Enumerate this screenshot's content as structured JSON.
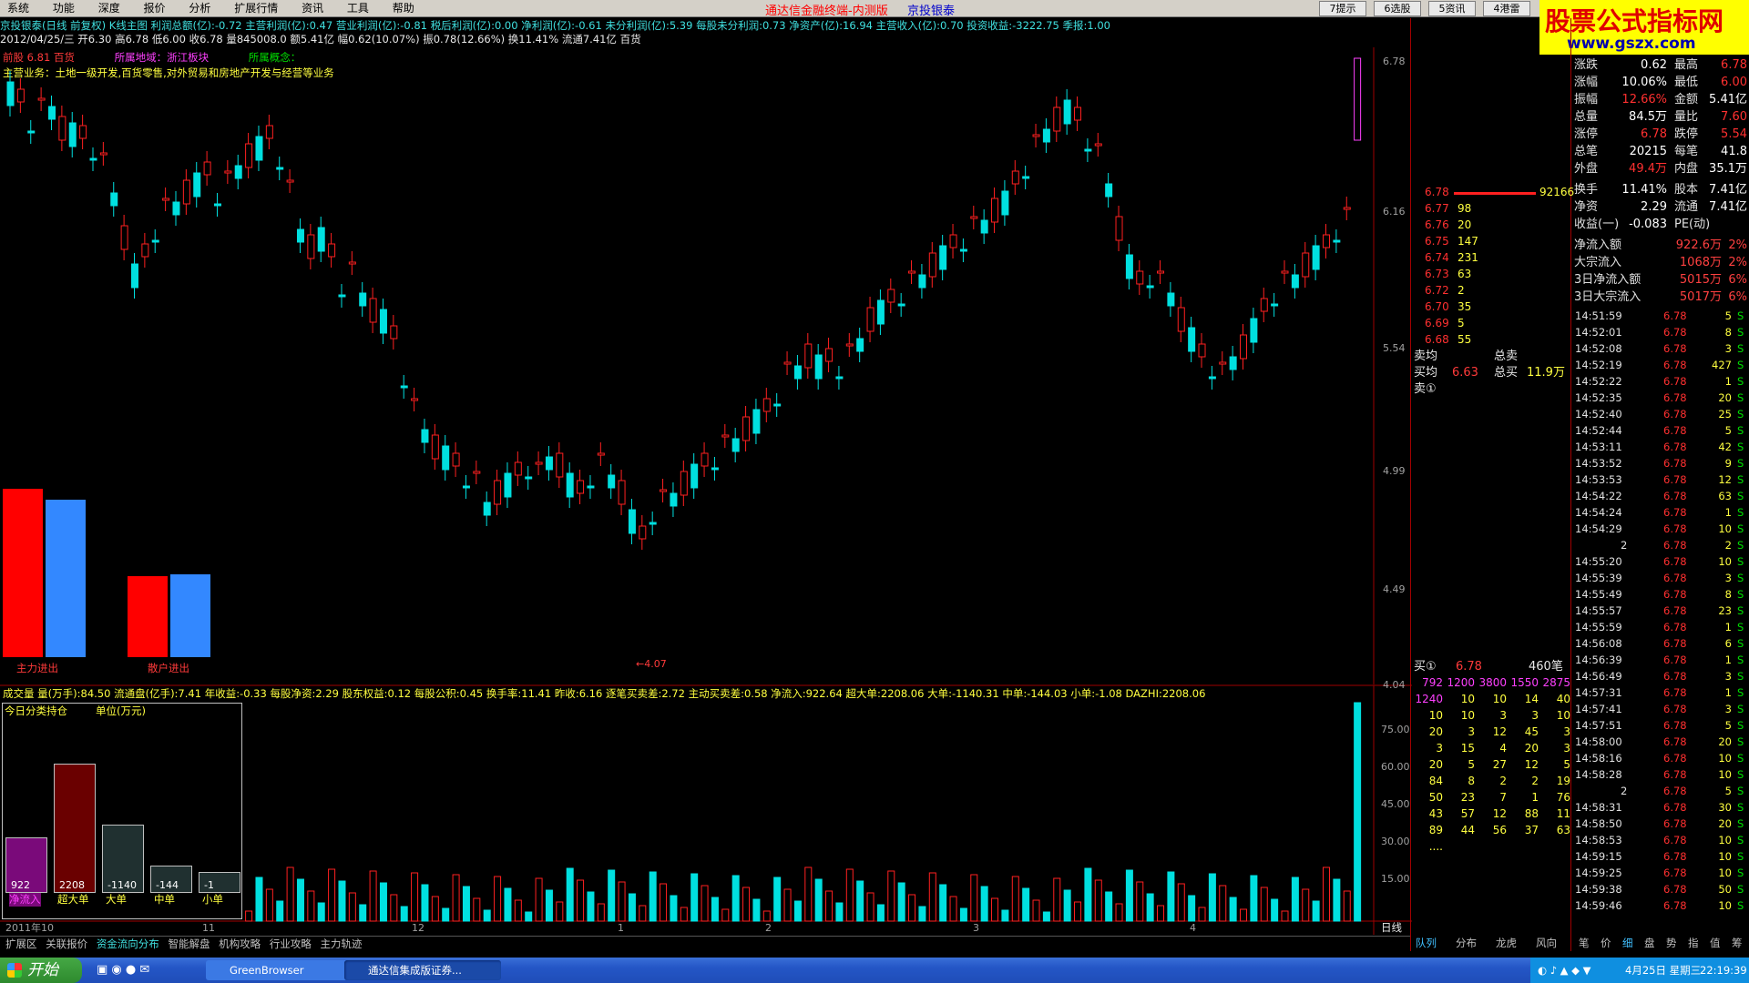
{
  "menu": [
    "系统",
    "功能",
    "深度",
    "报价",
    "分析",
    "扩展行情",
    "资讯",
    "工具",
    "帮助"
  ],
  "menu_center_title": "通达信金融终端-内测版",
  "menu_center_name": "京投银泰",
  "top_buttons": [
    "7提示",
    "6选股",
    "5资讯",
    "4港雷"
  ],
  "watermark": {
    "line1": "股票公式指标网",
    "line2": "www.gszx.com"
  },
  "info_line1": "京投银泰(日线 前复权) K线主图   利润总额(亿):-0.72  主营利润(亿):0.47  营业利润(亿):-0.81  税后利润(亿):0.00  净利润(亿):-0.61  未分利润(亿):5.39  每股未分利润:0.73  净资产(亿):16.94  主营收入(亿):0.70  投资收益:-3222.75  季报:1.00",
  "info_line2": "2012/04/25/三  开6.30  高6.78  低6.00  收6.78  量845008.0  额5.41亿  幅0.62(10.07%)  振0.78(12.66%)  换11.41%  流通7.41亿  百货",
  "info_line3": {
    "a": "前股 6.81  百货",
    "b": "所属地域：浙江板块",
    "c": "所属概念："
  },
  "info_line4": "主营业务：土地一级开发,百货零售,对外贸易和房地产开发与经营等业务",
  "price_axis": [
    "6.78",
    "6.16",
    "5.54",
    "4.99",
    "4.49",
    "4.04"
  ],
  "price_annot": "4.07",
  "flow_labels": {
    "main": "主力进出",
    "retail": "散户进出"
  },
  "vol_info": "成交量  量(万手):84.50  流通盘(亿手):7.41  年收益:-0.33  每股净资:2.29  股东权益:0.12  每股公积:0.45  换手率:11.41  昨收:6.16  逐笔买卖差:2.72  主动买卖差:0.58  净流入:922.64  超大单:2208.06  大单:-1140.31  中单:-144.03  小单:-1.08  DAZHI:2208.06",
  "vol_axis": [
    "75.00",
    "60.00",
    "45.00",
    "30.00",
    "15.00"
  ],
  "holdings": {
    "title": "今日分类持仓",
    "unit": "单位(万元)",
    "bars": [
      {
        "label": "净流入",
        "value": "922",
        "frac": 0.42,
        "color": "#7a0a7a"
      },
      {
        "label": "超大单",
        "value": "2208",
        "frac": 1.0,
        "color": "#6a0000"
      },
      {
        "label": "大单",
        "value": "-1140",
        "frac": 0.52,
        "color": "#203030"
      },
      {
        "label": "中单",
        "value": "-144",
        "frac": 0.2,
        "color": "#203030"
      },
      {
        "label": "小单",
        "value": "-1",
        "frac": 0.15,
        "color": "#203030"
      }
    ]
  },
  "date_axis": [
    "2011年10",
    "11",
    "12",
    "1",
    "2",
    "3",
    "4"
  ],
  "period_label": "日线",
  "bottom_tabs": [
    "扩展区",
    "关联报价",
    "资金流向分布",
    "智能解盘",
    "机构攻略",
    "行业攻略",
    "主力轨迹"
  ],
  "right_tabs": [
    "队列",
    "分布",
    "龙虎",
    "风向"
  ],
  "right_mini_tabs": [
    "笔",
    "价",
    "细",
    "盘",
    "势",
    "指",
    "值",
    "筹"
  ],
  "quote": [
    {
      "l": "涨跌",
      "v": "0.62",
      "l2": "最高",
      "v2": "6.78"
    },
    {
      "l": "涨幅",
      "v": "10.06%",
      "l2": "最低",
      "v2": "6.00"
    },
    {
      "l": "振幅",
      "v": "12.66%",
      "l2": "金额",
      "v2": "5.41亿"
    },
    {
      "l": "总量",
      "v": "84.5万",
      "l2": "量比",
      "v2": "7.60"
    },
    {
      "l": "涨停",
      "v": "6.78",
      "l2": "跌停",
      "v2": "5.54"
    },
    {
      "l": "总笔",
      "v": "20215",
      "l2": "每笔",
      "v2": "41.8"
    },
    {
      "l": "外盘",
      "v": "49.4万",
      "l2": "内盘",
      "v2": "35.1万"
    },
    {
      "l": "换手",
      "v": "11.41%",
      "l2": "股本",
      "v2": "7.41亿"
    },
    {
      "l": "净资",
      "v": "2.29",
      "l2": "流通",
      "v2": "7.41亿"
    },
    {
      "l": "收益(一)",
      "v": "-0.083",
      "l2": "PE(动)",
      "v2": ""
    },
    {
      "l": "净流入额",
      "v": "922.6万",
      "l2": "",
      "v2": "2%"
    },
    {
      "l": "大宗流入",
      "v": "1068万",
      "l2": "",
      "v2": "2%"
    },
    {
      "l": "3日净流入额",
      "v": "5015万",
      "l2": "",
      "v2": "6%"
    },
    {
      "l": "3日大宗流入",
      "v": "5017万",
      "l2": "",
      "v2": "6%"
    }
  ],
  "sell_levels": [
    {
      "p": "6.78",
      "q": "92166"
    },
    {
      "p": "6.77",
      "q": "98"
    },
    {
      "p": "6.76",
      "q": "20"
    },
    {
      "p": "6.75",
      "q": "147"
    },
    {
      "p": "6.74",
      "q": "231"
    },
    {
      "p": "6.73",
      "q": "63"
    },
    {
      "p": "6.72",
      "q": "2"
    },
    {
      "p": "6.70",
      "q": "35"
    },
    {
      "p": "6.69",
      "q": "5"
    },
    {
      "p": "6.68",
      "q": "55"
    }
  ],
  "avg": {
    "sell_avg": "卖均",
    "total_sell": "总卖",
    "buy_avg": "买均",
    "buy_avg_v": "6.63",
    "total_buy": "总买",
    "total_buy_v": "11.9万",
    "sell1": "卖①"
  },
  "buy1": {
    "label": "买①",
    "price": "6.78",
    "count": "460笔"
  },
  "queue": [
    [
      "792",
      "1200",
      "3800",
      "1550",
      "2875"
    ],
    [
      "1240",
      "10",
      "10",
      "14",
      "40"
    ],
    [
      "10",
      "10",
      "3",
      "3",
      "10"
    ],
    [
      "20",
      "3",
      "12",
      "45",
      "3"
    ],
    [
      "3",
      "15",
      "4",
      "20",
      "3"
    ],
    [
      "20",
      "5",
      "27",
      "12",
      "5"
    ],
    [
      "84",
      "8",
      "2",
      "2",
      "19"
    ],
    [
      "50",
      "23",
      "7",
      "1",
      "76"
    ],
    [
      "43",
      "57",
      "12",
      "88",
      "11"
    ],
    [
      "89",
      "44",
      "56",
      "37",
      "63"
    ],
    [
      "....",
      "",
      "",
      "",
      ""
    ]
  ],
  "ticks": [
    [
      "14:51:59",
      "6.78",
      "5",
      "S"
    ],
    [
      "14:52:01",
      "6.78",
      "8",
      "S"
    ],
    [
      "14:52:08",
      "6.78",
      "3",
      "S"
    ],
    [
      "14:52:19",
      "6.78",
      "427",
      "S"
    ],
    [
      "14:52:22",
      "6.78",
      "1",
      "S"
    ],
    [
      "14:52:35",
      "6.78",
      "20",
      "S"
    ],
    [
      "14:52:40",
      "6.78",
      "25",
      "S"
    ],
    [
      "14:52:44",
      "6.78",
      "5",
      "S"
    ],
    [
      "14:53:11",
      "6.78",
      "42",
      "S"
    ],
    [
      "14:53:52",
      "6.78",
      "9",
      "S"
    ],
    [
      "14:53:53",
      "6.78",
      "12",
      "S"
    ],
    [
      "14:54:22",
      "6.78",
      "63",
      "S"
    ],
    [
      "14:54:24",
      "6.78",
      "1",
      "S"
    ],
    [
      "14:54:29",
      "6.78",
      "10",
      "S"
    ],
    [
      "2",
      "6.78",
      "2",
      "S"
    ],
    [
      "14:55:20",
      "6.78",
      "10",
      "S"
    ],
    [
      "14:55:39",
      "6.78",
      "3",
      "S"
    ],
    [
      "14:55:49",
      "6.78",
      "8",
      "S"
    ],
    [
      "14:55:57",
      "6.78",
      "23",
      "S"
    ],
    [
      "14:55:59",
      "6.78",
      "1",
      "S"
    ],
    [
      "14:56:08",
      "6.78",
      "6",
      "S"
    ],
    [
      "14:56:39",
      "6.78",
      "1",
      "S"
    ],
    [
      "14:56:49",
      "6.78",
      "3",
      "S"
    ],
    [
      "14:57:31",
      "6.78",
      "1",
      "S"
    ],
    [
      "14:57:41",
      "6.78",
      "3",
      "S"
    ],
    [
      "14:57:51",
      "6.78",
      "5",
      "S"
    ],
    [
      "14:58:00",
      "6.78",
      "20",
      "S"
    ],
    [
      "14:58:16",
      "6.78",
      "10",
      "S"
    ],
    [
      "14:58:28",
      "6.78",
      "10",
      "S"
    ],
    [
      "2",
      "6.78",
      "5",
      "S"
    ],
    [
      "14:58:31",
      "6.78",
      "30",
      "S"
    ],
    [
      "14:58:50",
      "6.78",
      "20",
      "S"
    ],
    [
      "14:58:53",
      "6.78",
      "10",
      "S"
    ],
    [
      "14:59:15",
      "6.78",
      "10",
      "S"
    ],
    [
      "14:59:25",
      "6.78",
      "10",
      "S"
    ],
    [
      "14:59:38",
      "6.78",
      "50",
      "S"
    ],
    [
      "14:59:46",
      "6.78",
      "10",
      "S"
    ]
  ],
  "taskbar": {
    "start": "开始",
    "btn1": "GreenBrowser",
    "btn2": "通达信集成版证券...",
    "date": "4月25日 星期三",
    "time": "22:19:39"
  },
  "colors": {
    "up": "#ff0000",
    "down": "#00e0e0",
    "flow_main_in": "#ff0000",
    "flow_main_out": "#3388ff"
  }
}
